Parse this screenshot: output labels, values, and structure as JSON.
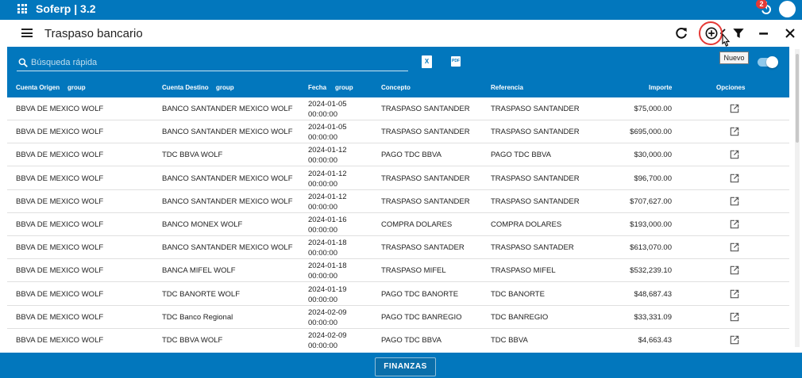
{
  "app": {
    "title": "Soferp | 3.2",
    "notification_count": "2"
  },
  "header": {
    "title": "Traspaso bancario"
  },
  "tooltip": {
    "text": "Nuevo"
  },
  "search": {
    "placeholder": "Búsqueda rápida",
    "value": ""
  },
  "columns": {
    "origen": "Cuenta Origen",
    "origen_group": "group",
    "destino": "Cuenta Destino",
    "destino_group": "group",
    "fecha": "Fecha",
    "fecha_group": "group",
    "concepto": "Concepto",
    "referencia": "Referencia",
    "importe": "Importe",
    "opciones": "Opciones"
  },
  "rows": [
    {
      "origen": "BBVA DE MEXICO WOLF",
      "destino": "BANCO SANTANDER MEXICO WOLF",
      "fecha_date": "2024-01-05",
      "fecha_time": "00:00:00",
      "concepto": "TRASPASO SANTANDER",
      "referencia": "TRASPASO SANTANDER",
      "importe": "$75,000.00"
    },
    {
      "origen": "BBVA DE MEXICO WOLF",
      "destino": "BANCO SANTANDER MEXICO WOLF",
      "fecha_date": "2024-01-05",
      "fecha_time": "00:00:00",
      "concepto": "TRASPASO SANTANDER",
      "referencia": "TRASPASO SANTANDER",
      "importe": "$695,000.00"
    },
    {
      "origen": "BBVA DE MEXICO WOLF",
      "destino": "TDC BBVA WOLF",
      "fecha_date": "2024-01-12",
      "fecha_time": "00:00:00",
      "concepto": "PAGO TDC BBVA",
      "referencia": "PAGO TDC BBVA",
      "importe": "$30,000.00"
    },
    {
      "origen": "BBVA DE MEXICO WOLF",
      "destino": "BANCO SANTANDER MEXICO WOLF",
      "fecha_date": "2024-01-12",
      "fecha_time": "00:00:00",
      "concepto": "TRASPASO SANTANDER",
      "referencia": "TRASPASO SANTANDER",
      "importe": "$96,700.00"
    },
    {
      "origen": "BBVA DE MEXICO WOLF",
      "destino": "BANCO SANTANDER MEXICO WOLF",
      "fecha_date": "2024-01-12",
      "fecha_time": "00:00:00",
      "concepto": "TRASPASO SANTANDER",
      "referencia": "TRASPASO SANTANDER",
      "importe": "$707,627.00"
    },
    {
      "origen": "BBVA DE MEXICO WOLF",
      "destino": "BANCO MONEX WOLF",
      "fecha_date": "2024-01-16",
      "fecha_time": "00:00:00",
      "concepto": "COMPRA DOLARES",
      "referencia": "COMPRA DOLARES",
      "importe": "$193,000.00"
    },
    {
      "origen": "BBVA DE MEXICO WOLF",
      "destino": "BANCO SANTANDER MEXICO WOLF",
      "fecha_date": "2024-01-18",
      "fecha_time": "00:00:00",
      "concepto": "TRASPASO SANTADER",
      "referencia": "TRASPASO SANTADER",
      "importe": "$613,070.00"
    },
    {
      "origen": "BBVA DE MEXICO WOLF",
      "destino": "BANCA MIFEL WOLF",
      "fecha_date": "2024-01-18",
      "fecha_time": "00:00:00",
      "concepto": "TRASPASO MIFEL",
      "referencia": "TRASPASO MIFEL",
      "importe": "$532,239.10"
    },
    {
      "origen": "BBVA DE MEXICO WOLF",
      "destino": "TDC BANORTE WOLF",
      "fecha_date": "2024-01-19",
      "fecha_time": "00:00:00",
      "concepto": "PAGO TDC BANORTE",
      "referencia": "TDC BANORTE",
      "importe": "$48,687.43"
    },
    {
      "origen": "BBVA DE MEXICO WOLF",
      "destino": "TDC Banco Regional",
      "fecha_date": "2024-02-09",
      "fecha_time": "00:00:00",
      "concepto": "PAGO TDC BANREGIO",
      "referencia": "TDC BANREGIO",
      "importe": "$33,331.09"
    },
    {
      "origen": "BBVA DE MEXICO WOLF",
      "destino": "TDC BBVA WOLF",
      "fecha_date": "2024-02-09",
      "fecha_time": "00:00:00",
      "concepto": "PAGO TDC BBVA",
      "referencia": "TDC BBVA",
      "importe": "$4,663.43"
    }
  ],
  "footer": {
    "button_label": "FINANZAS"
  },
  "colors": {
    "primary": "#0277bd",
    "accent_ring": "#e53935",
    "toggle_track": "#8fc9ec"
  },
  "icons": {
    "apps": "apps-grid-icon",
    "sync": "sync-icon",
    "menu": "hamburger-menu-icon",
    "refresh": "refresh-icon",
    "add": "add-circle-icon",
    "expand": "chevrons-left-icon",
    "filter": "filter-icon",
    "minimize": "minimize-icon",
    "close": "close-icon",
    "search": "search-icon",
    "excel": "excel-export-icon",
    "pdf": "pdf-export-icon",
    "edit": "open-in-new-icon"
  }
}
